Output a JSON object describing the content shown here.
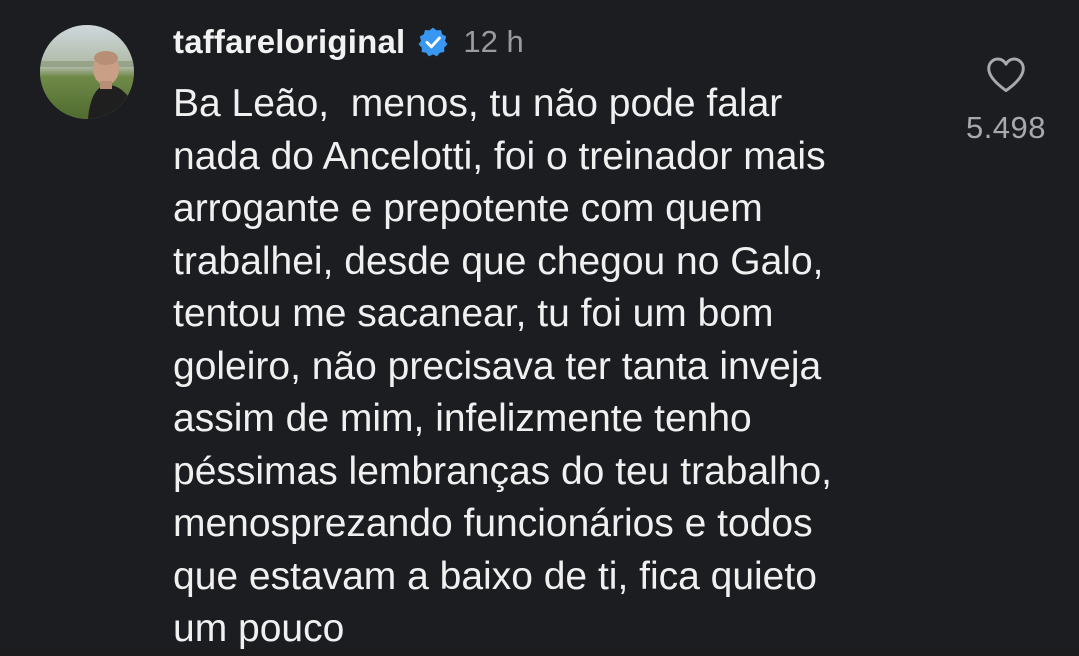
{
  "comment": {
    "username": "taffareloriginal",
    "verified_icon": "verified-badge-icon",
    "timestamp": "12 h",
    "lines": [
      "Ba Leão,  menos, tu não pode falar",
      "nada do Ancelotti, foi o treinador mais",
      "arrogante e prepotente com quem",
      "trabalhei, desde que chegou no Galo,",
      "tentou me sacanear, tu foi um bom",
      "goleiro, não precisava ter tanta inveja",
      "assim de mim, infelizmente tenho",
      "péssimas lembranças do teu trabalho,",
      "menosprezando funcionários e todos",
      "que estavam a baixo de ti, fica quieto",
      "um pouco"
    ],
    "like_icon": "heart-outline-icon",
    "like_count": "5.498"
  },
  "colors": {
    "background": "#1c1d21",
    "verified_blue": "#3897f0",
    "muted_text": "#9a9a9f"
  }
}
